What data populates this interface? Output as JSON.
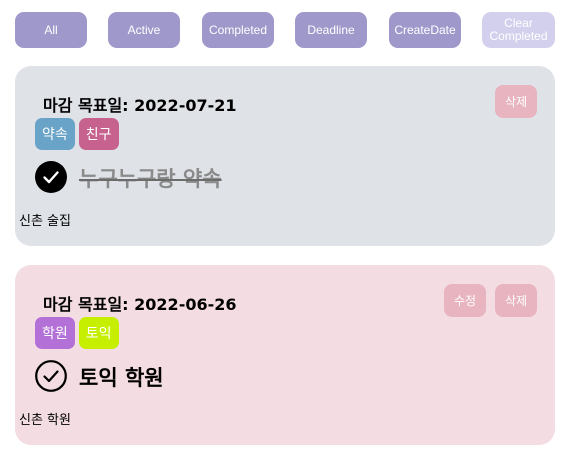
{
  "filters": [
    {
      "label": "All"
    },
    {
      "label": "Active"
    },
    {
      "label": "Completed"
    },
    {
      "label": "Deadline"
    },
    {
      "label": "CreateDate"
    },
    {
      "label": "Clear Completed",
      "line1": "Clear",
      "line2": "Completed"
    }
  ],
  "todos": [
    {
      "deadline_label": "마감 목표일:",
      "deadline_date": "2022-07-21",
      "tags": [
        {
          "label": "약속",
          "color": "#6aa3c8"
        },
        {
          "label": "친구",
          "color": "#c7628f"
        }
      ],
      "title": "누구누구랑 약속",
      "completed": true,
      "description": "신촌 술집",
      "delete_label": "삭제"
    },
    {
      "deadline_label": "마감 목표일:",
      "deadline_date": "2022-06-26",
      "tags": [
        {
          "label": "학원",
          "color": "#b370d6"
        },
        {
          "label": "토익",
          "color": "#c6ef00"
        }
      ],
      "title": "토익 학원",
      "completed": false,
      "description": "신촌 학원",
      "edit_label": "수정",
      "delete_label": "삭제"
    }
  ]
}
